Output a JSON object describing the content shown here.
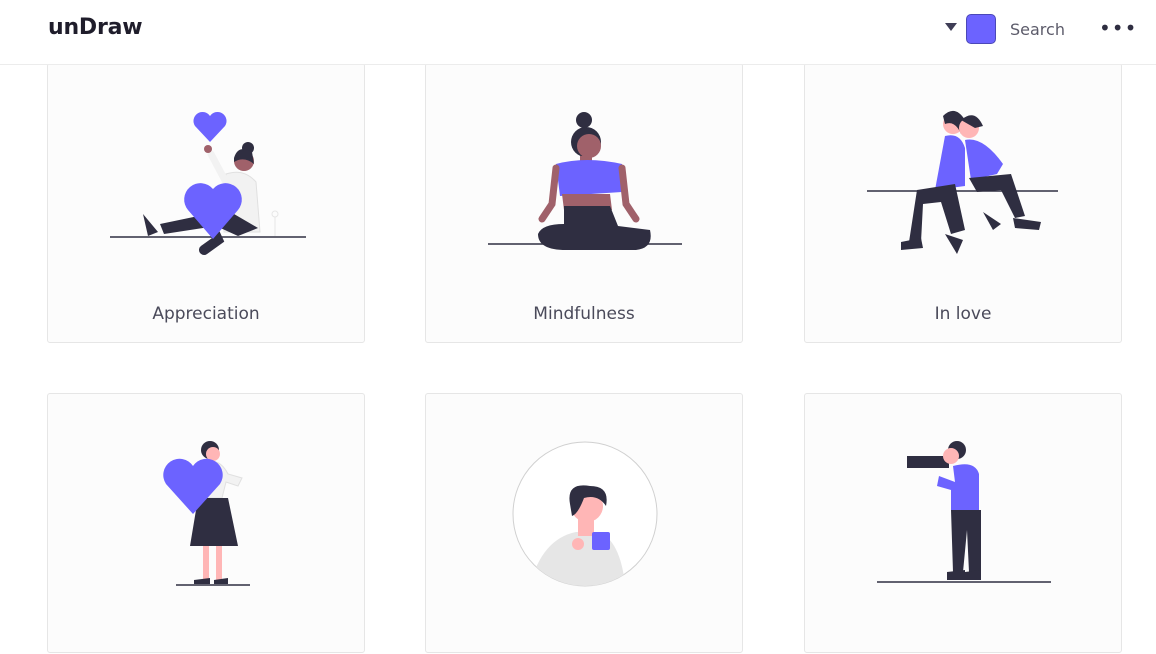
{
  "header": {
    "logo": "unDraw",
    "search_label": "Search",
    "more_label": "•••",
    "accent_color": "#6c63ff"
  },
  "illustrations": [
    {
      "title": "Appreciation"
    },
    {
      "title": "Mindfulness"
    },
    {
      "title": "In love"
    },
    {
      "title": ""
    },
    {
      "title": ""
    },
    {
      "title": ""
    }
  ],
  "colors": {
    "accent": "#6c63ff",
    "dark": "#2f2e41",
    "skin": "#a0616a",
    "light_skin": "#ffb6b6",
    "grey": "#e6e6e6"
  }
}
